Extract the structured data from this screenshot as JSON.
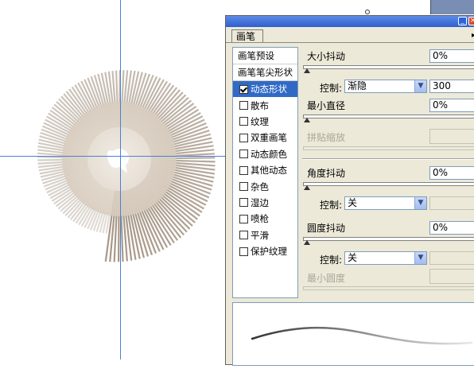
{
  "palette": {
    "tab_label": "画笔",
    "left_list": {
      "headers": [
        "画笔预设",
        "画笔笔尖形状"
      ],
      "options": [
        {
          "label": "动态形状",
          "checked": true,
          "selected": true
        },
        {
          "label": "散布",
          "checked": false,
          "selected": false
        },
        {
          "label": "纹理",
          "checked": false,
          "selected": false
        },
        {
          "label": "双重画笔",
          "checked": false,
          "selected": false
        },
        {
          "label": "动态颜色",
          "checked": false,
          "selected": false
        },
        {
          "label": "其他动态",
          "checked": false,
          "selected": false
        },
        {
          "label": "杂色",
          "checked": false,
          "selected": false
        },
        {
          "label": "湿边",
          "checked": false,
          "selected": false
        },
        {
          "label": "喷枪",
          "checked": false,
          "selected": false
        },
        {
          "label": "平滑",
          "checked": false,
          "selected": false
        },
        {
          "label": "保护纹理",
          "checked": false,
          "selected": false
        }
      ]
    },
    "settings": {
      "size_jitter_label": "大小抖动",
      "size_jitter_value": "0%",
      "size_control_label": "控制:",
      "size_control_value": "渐隐",
      "size_fade_value": "300",
      "min_diameter_label": "最小直径",
      "min_diameter_value": "0%",
      "tilt_scale_label": "拼贴缩放",
      "angle_jitter_label": "角度抖动",
      "angle_jitter_value": "0%",
      "angle_control_label": "控制:",
      "angle_control_value": "关",
      "roundness_jitter_label": "圆度抖动",
      "roundness_jitter_value": "0%",
      "roundness_control_label": "控制:",
      "roundness_control_value": "关",
      "min_roundness_label": "最小圆度"
    }
  },
  "colors": {
    "guide": "#4a7fd6",
    "brush_stroke": "#8a7660",
    "selection": "#316ac5",
    "panel_bg": "#ece9d8"
  },
  "icons": [
    "minimize-icon",
    "close-icon",
    "palette-menu-icon",
    "dropdown-arrow-icon",
    "checkbox-icon"
  ]
}
